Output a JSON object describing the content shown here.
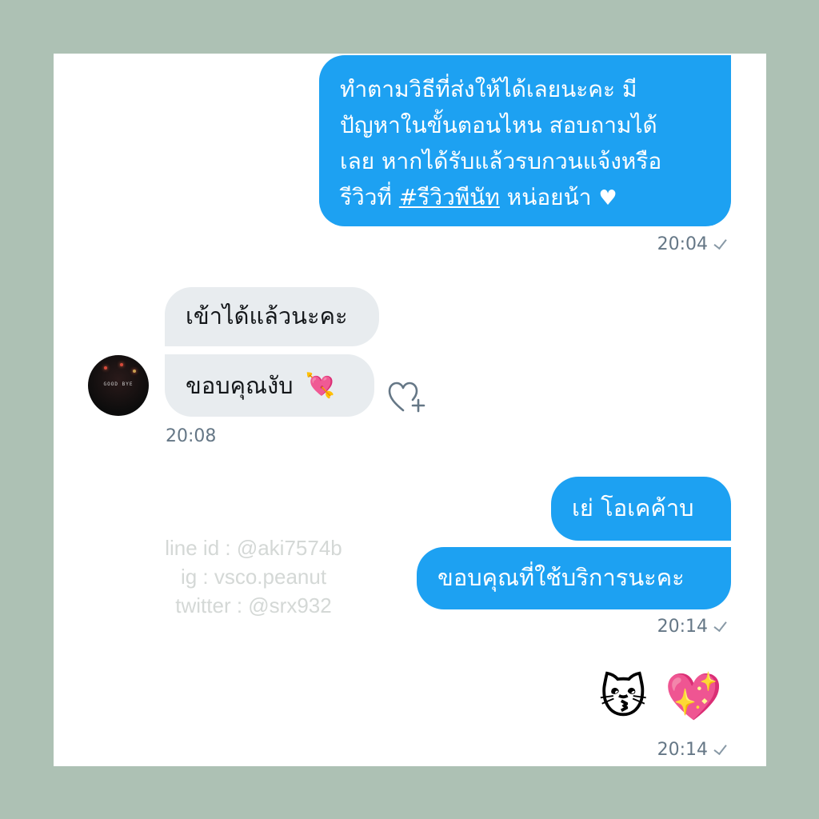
{
  "messages": {
    "out1": {
      "line1": "ทำตามวิธีที่ส่งให้ได้เลยนะคะ มี",
      "line2": "ปัญหาในขั้นตอนไหน สอบถามได้",
      "line3": "เลย หากได้รับแล้วรบกวนแจ้งหรือ",
      "line4_prefix": "รีวิวที่ ",
      "hashtag": "#รีวิวพีนัท",
      "line4_suffix": " หน่อยน้า ",
      "heart": "♥",
      "time": "20:04"
    },
    "in1": {
      "text": "เข้าได้แล้วนะคะ"
    },
    "in2": {
      "text": "ขอบคุณงับ",
      "emoji": "💘",
      "time": "20:08"
    },
    "out2": {
      "text": "เย่ โอเคค้าบ"
    },
    "out3": {
      "text": "ขอบคุณที่ใช้บริการนะคะ",
      "time": "20:14"
    },
    "out4": {
      "emoji1": "😽",
      "emoji2": "💖",
      "time": "20:14"
    }
  },
  "avatar": {
    "caption": "GOOD BYE"
  },
  "watermark": {
    "line": "line id : @aki7574b",
    "ig": "ig : vsco.peanut",
    "twitter": "twitter : @srx932"
  },
  "icons": {
    "react": "heart-plus-icon",
    "read": "check-icon"
  },
  "colors": {
    "background": "#adc1b4",
    "card": "#ffffff",
    "outgoing_bubble": "#1da1f2",
    "incoming_bubble": "#e8ecef",
    "timestamp": "#657786"
  }
}
